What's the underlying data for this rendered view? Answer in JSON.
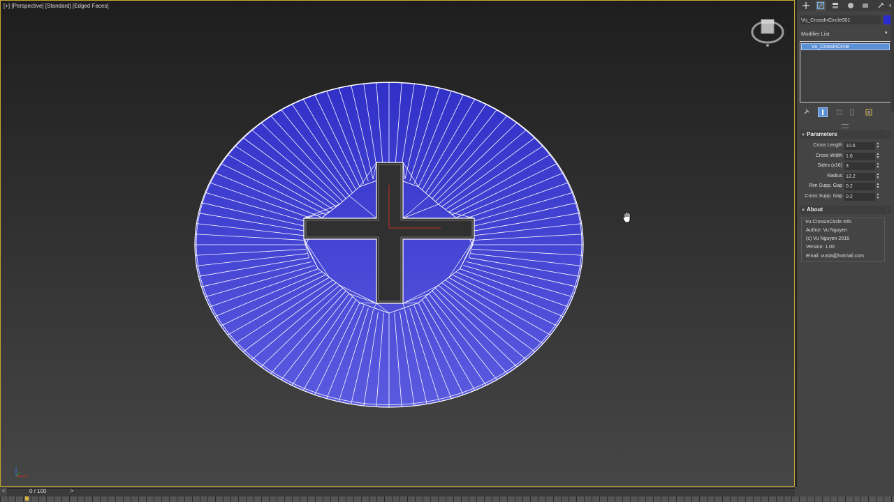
{
  "viewport": {
    "bracket_plus": "[+]",
    "bracket_view": "[Perspective]",
    "bracket_shading": "[Standard]",
    "bracket_faces": "[Edged Faces]",
    "object_color": "#3434c8",
    "wire_color": "#ffffff"
  },
  "timeline": {
    "frame": "0 / 100",
    "prev": "<",
    "next": ">"
  },
  "command_panel": {
    "tabs": [
      "create-icon",
      "modify-icon",
      "hierarchy-icon",
      "motion-icon",
      "display-icon",
      "utilities-icon"
    ],
    "object_name": "Vu_CrossInCircle001",
    "object_color": "#2b2bd4",
    "modifier_list_label": "Modifier List",
    "modifier_list_arrow": "▾",
    "modifier_stack": [
      "Vu_CrossInCircle"
    ],
    "parameters": {
      "title": "Parameters",
      "rows": [
        {
          "label": "Cross Length",
          "value": "10.6"
        },
        {
          "label": "Cross Width",
          "value": "1.6"
        },
        {
          "label": "Sides (x16)",
          "value": "3"
        },
        {
          "label": "Radius",
          "value": "12.2"
        },
        {
          "label": "Rim Supp. Gap",
          "value": "0.2"
        },
        {
          "label": "Cross Supp. Gap",
          "value": "0.2"
        }
      ]
    },
    "about": {
      "title": "About",
      "box_title": "Vu CrossInCircle Info",
      "lines": [
        "Author: Vu Nguyen",
        "(c) Vu Nguyen 2016",
        "Version: 1.00",
        "Email: vusta@hotmail.com"
      ]
    }
  }
}
